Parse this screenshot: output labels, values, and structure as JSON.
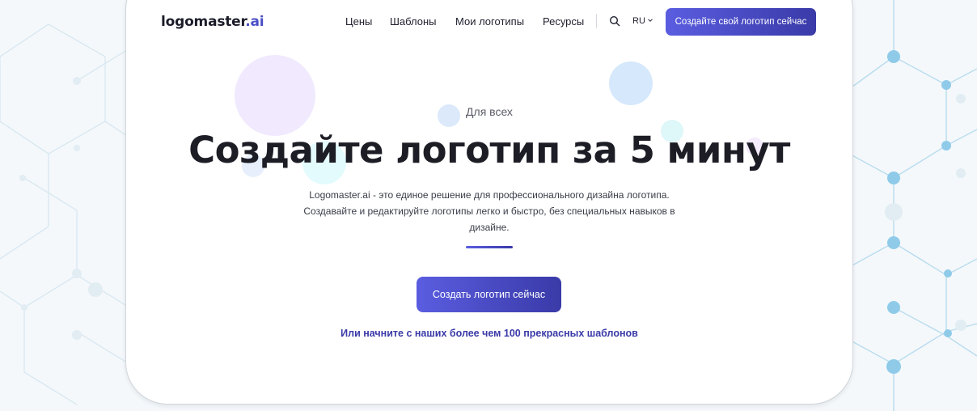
{
  "header": {
    "logo_main": "logomaster",
    "logo_suffix": ".ai",
    "nav": [
      "Цены",
      "Шаблоны",
      "Мои логотипы",
      "Ресурсы"
    ],
    "language": "RU",
    "cta": "Создайте свой логотип сейчас"
  },
  "hero": {
    "eyebrow": "Для всех",
    "headline": "Создайте логотип за 5 минут",
    "description": "Logomaster.ai - это единое решение для профессионального дизайна логотипа. Создавайте и редактируйте логотипы легко и быстро, без специальных навыков в дизайне.",
    "cta": "Создать логотип сейчас",
    "templates_link": "Или начните с наших более чем 100 прекрасных шаблонов"
  },
  "colors": {
    "accent": "#4b4fc6",
    "accent_dark": "#3a3aa8",
    "background_pattern": "#7ec4e6"
  },
  "icons": {
    "search": "search-icon",
    "language_chevron": "chevron-down-icon"
  }
}
